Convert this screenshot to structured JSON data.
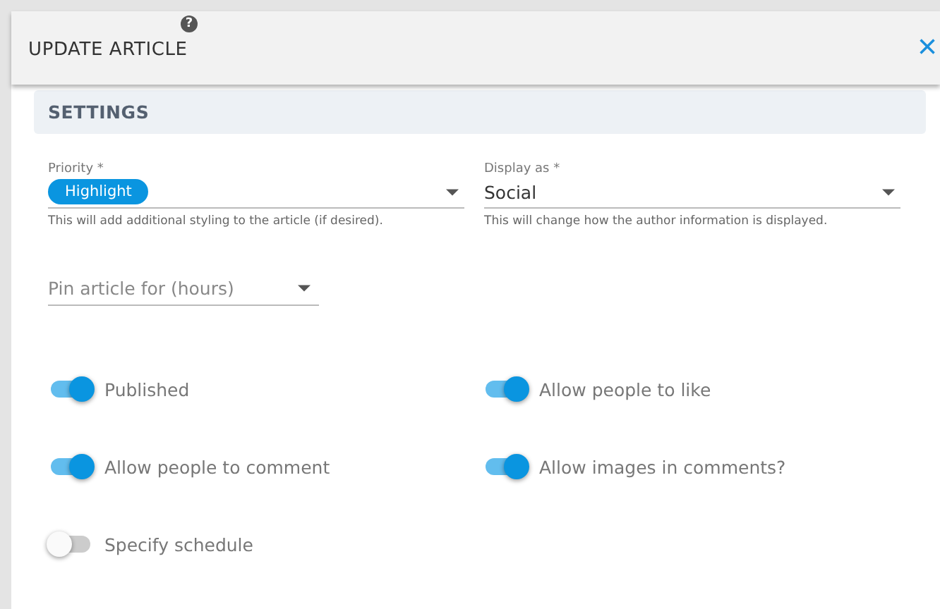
{
  "dialog": {
    "title": "UPDATE ARTICLE",
    "help": "?",
    "close": "×"
  },
  "section": {
    "title": "SETTINGS"
  },
  "selects": [
    {
      "label": "Priority *",
      "value": "Highlight",
      "kind": "chip",
      "hint": "This will add additional styling to the article (if desired)."
    },
    {
      "label": "Display as *",
      "value": "Social",
      "kind": "text",
      "hint": "This will change how the author information is displayed."
    }
  ],
  "pin": {
    "placeholder": "Pin article for (hours)"
  },
  "toggles": [
    {
      "label": "Published",
      "on": true
    },
    {
      "label": "Allow people to like",
      "on": true
    },
    {
      "label": "Allow people to comment",
      "on": true
    },
    {
      "label": "Allow images in comments?",
      "on": true
    },
    {
      "label": "Specify schedule",
      "on": false
    }
  ]
}
